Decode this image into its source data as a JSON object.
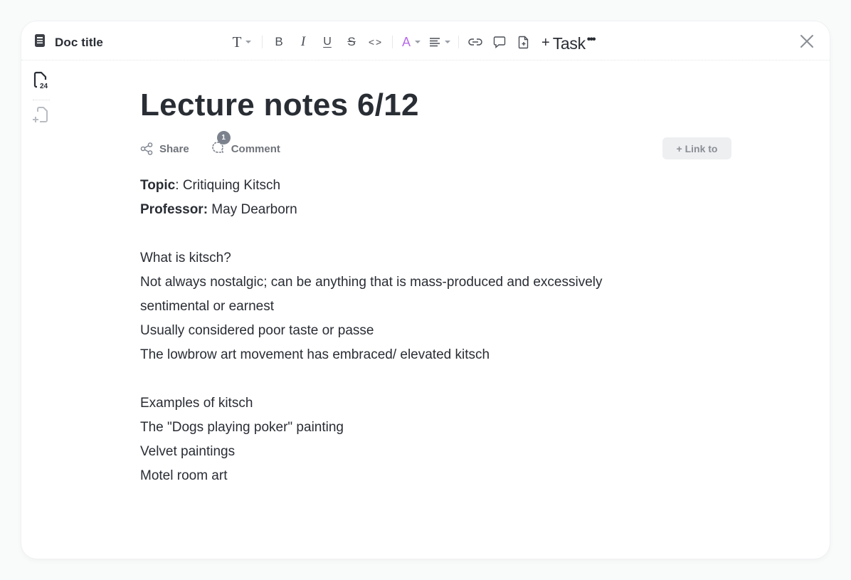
{
  "header": {
    "doc_title": "Doc title",
    "toolbar": {
      "text_style": "T",
      "bold": "B",
      "italic": "I",
      "underline": "U",
      "strikethrough": "S",
      "code": "<>",
      "text_color": "A",
      "text_color_hex": "#b76be8",
      "task_plus": "+",
      "task_label": "Task",
      "more": "•••"
    }
  },
  "sidebar": {
    "page_count": "24"
  },
  "document": {
    "title": "Lecture notes 6/12",
    "share_label": "Share",
    "comment_label": "Comment",
    "comment_count": "1",
    "link_to_label": "+ Link to",
    "topic_label": "Topic",
    "topic_sep": ": ",
    "topic_value": "Critiquing Kitsch",
    "professor_label": "Professor:",
    "professor_value": " May Dearborn",
    "section1": [
      "What is kitsch?",
      "Not always nostalgic; can be anything that is mass-produced and excessively",
      "sentimental or earnest",
      "Usually considered poor taste or passe",
      "The lowbrow art movement has embraced/ elevated kitsch"
    ],
    "section2": [
      "Examples of kitsch",
      "The \"Dogs playing poker\" painting",
      "Velvet paintings",
      "Motel room art"
    ]
  }
}
